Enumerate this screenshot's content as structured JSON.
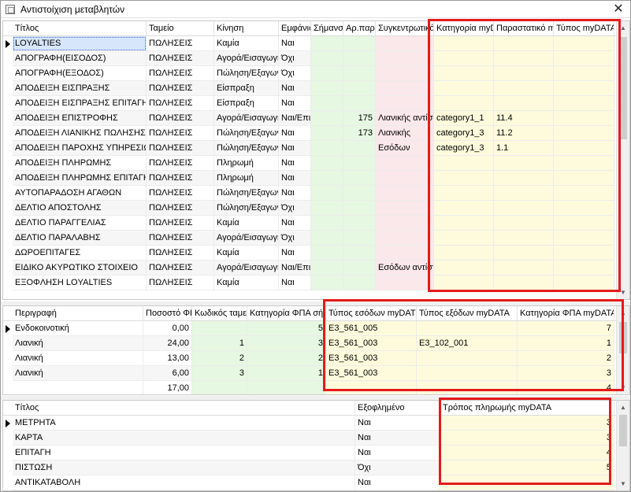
{
  "window": {
    "title": "Αντιστοίχιση μεταβλητών",
    "close_glyph": "✕"
  },
  "grid1": {
    "columns": [
      "Τίτλος",
      "Ταμείο",
      "Κίνηση",
      "Εμφάνισ",
      "Σήμανσ",
      "Αρ.παρ",
      "Συγκεντρωτικό",
      "Κατηγορία myDATA",
      "Παραστατικό myDATA",
      "Τύπος myDATA"
    ],
    "rows": [
      [
        "LOYALTIES",
        "ΠΩΛΗΣΕΙΣ",
        "Καμία",
        "Ναι",
        "",
        "",
        "",
        "",
        "",
        ""
      ],
      [
        "ΑΠΟΓΡΑΦΗ(ΕΙΣΟΔΟΣ)",
        "ΠΩΛΗΣΕΙΣ",
        "Αγορά/Εισαγωγή",
        "Όχι",
        "",
        "",
        "",
        "",
        "",
        ""
      ],
      [
        "ΑΠΟΓΡΑΦΗ(ΕΞΟΔΟΣ)",
        "ΠΩΛΗΣΕΙΣ",
        "Πώληση/Εξαγωγή",
        "Όχι",
        "",
        "",
        "",
        "",
        "",
        ""
      ],
      [
        "ΑΠΟΔΕΙΞΗ ΕΙΣΠΡΑΞΗΣ",
        "ΠΩΛΗΣΕΙΣ",
        "Είσπραξη",
        "Ναι",
        "",
        "",
        "",
        "",
        "",
        ""
      ],
      [
        "ΑΠΟΔΕΙΞΗ ΕΙΣΠΡΑΞΗΣ ΕΠΙΤΑΓΗ",
        "ΠΩΛΗΣΕΙΣ",
        "Είσπραξη",
        "Ναι",
        "",
        "",
        "",
        "",
        "",
        ""
      ],
      [
        "ΑΠΟΔΕΙΞΗ ΕΠΙΣΤΡΟΦΗΣ",
        "ΠΩΛΗΣΕΙΣ",
        "Αγορά/Εισαγωγή",
        "Ναι/Επιτ",
        "",
        "175",
        "Λιανικής αντίστ",
        "category1_1",
        "11.4",
        ""
      ],
      [
        "ΑΠΟΔΕΙΞΗ ΛΙΑΝΙΚΗΣ ΠΩΛΗΣΗΣ",
        "ΠΩΛΗΣΕΙΣ",
        "Πώληση/Εξαγωγή",
        "Ναι",
        "",
        "173",
        "Λιανικής",
        "category1_3",
        "11.2",
        ""
      ],
      [
        "ΑΠΟΔΕΙΞΗ ΠΑΡΟΧΗΣ ΥΠΗΡΕΣΙΩΝ",
        "ΠΩΛΗΣΕΙΣ",
        "Πώληση/Εξαγωγή",
        "Ναι",
        "",
        "",
        "Εσόδων",
        "category1_3",
        "1.1",
        ""
      ],
      [
        "ΑΠΟΔΕΙΞΗ ΠΛΗΡΩΜΗΣ",
        "ΠΩΛΗΣΕΙΣ",
        "Πληρωμή",
        "Ναι",
        "",
        "",
        "",
        "",
        "",
        ""
      ],
      [
        "ΑΠΟΔΕΙΞΗ ΠΛΗΡΩΜΗΣ ΕΠΙΤΑΓΗ",
        "ΠΩΛΗΣΕΙΣ",
        "Πληρωμή",
        "Ναι",
        "",
        "",
        "",
        "",
        "",
        ""
      ],
      [
        "ΑΥΤΟΠΑΡΑΔΟΣΗ ΑΓΑΘΩΝ",
        "ΠΩΛΗΣΕΙΣ",
        "Πώληση/Εξαγωγή",
        "Ναι",
        "",
        "",
        "",
        "",
        "",
        ""
      ],
      [
        "ΔΕΛΤΙΟ ΑΠΟΣΤΟΛΗΣ",
        "ΠΩΛΗΣΕΙΣ",
        "Πώληση/Εξαγωγή",
        "Όχι",
        "",
        "",
        "",
        "",
        "",
        ""
      ],
      [
        "ΔΕΛΤΙΟ ΠΑΡΑΓΓΕΛΙΑΣ",
        "ΠΩΛΗΣΕΙΣ",
        "Καμία",
        "Ναι",
        "",
        "",
        "",
        "",
        "",
        ""
      ],
      [
        "ΔΕΛΤΙΟ ΠΑΡΑΛΑΒΗΣ",
        "ΠΩΛΗΣΕΙΣ",
        "Αγορά/Εισαγωγή",
        "Όχι",
        "",
        "",
        "",
        "",
        "",
        ""
      ],
      [
        "ΔΩΡΟΕΠΙΤΑΓΕΣ",
        "ΠΩΛΗΣΕΙΣ",
        "Καμία",
        "Ναι",
        "",
        "",
        "",
        "",
        "",
        ""
      ],
      [
        "ΕΙΔΙΚΟ ΑΚΥΡΩΤΙΚΟ ΣΤΟΙΧΕΙΟ",
        "ΠΩΛΗΣΕΙΣ",
        "Αγορά/Εισαγωγή",
        "Ναι/Επιτ",
        "",
        "",
        "Εσόδων αντίστ",
        "",
        "",
        ""
      ],
      [
        "ΕΞΟΦΛΗΣΗ LOYALTIES",
        "ΠΩΛΗΣΕΙΣ",
        "Καμία",
        "Ναι",
        "",
        "",
        "",
        "",
        "",
        ""
      ]
    ]
  },
  "grid2": {
    "columns": [
      "Περιγραφή",
      "Ποσοστό ΦΠ",
      "Κωδικός ταμει",
      "Κατηγορία ΦΠΑ σήμ",
      "Τύπος εσόδων myDAT",
      "Τύπος εξόδων myDATA",
      "Κατηγορία ΦΠΑ myDATA"
    ],
    "rows": [
      [
        "Ενδοκοινοτική",
        "0,00",
        "",
        "5",
        "E3_561_005",
        "",
        "7"
      ],
      [
        "Λιανική",
        "24,00",
        "1",
        "3",
        "E3_561_003",
        "E3_102_001",
        "1"
      ],
      [
        "Λιανική",
        "13,00",
        "2",
        "2",
        "E3_561_003",
        "",
        "2"
      ],
      [
        "Λιανική",
        "6,00",
        "3",
        "1",
        "E3_561_003",
        "",
        "3"
      ],
      [
        "",
        "17,00",
        "",
        "",
        "",
        "",
        "4"
      ]
    ]
  },
  "grid3": {
    "columns": [
      "Τίτλος",
      "Εξοφλημένο",
      "Τρόπος πληρωμής myDATA"
    ],
    "rows": [
      [
        "ΜΕΤΡΗΤΑ",
        "Ναι",
        "3"
      ],
      [
        "ΚΑΡΤΑ",
        "Ναι",
        "3"
      ],
      [
        "ΕΠΙΤΑΓΗ",
        "Ναι",
        "4"
      ],
      [
        "ΠΙΣΤΩΣΗ",
        "Όχι",
        "5"
      ],
      [
        "ΑΝΤΙΚΑΤΑΒΟΛΗ",
        "Ναι",
        ""
      ]
    ]
  },
  "colors": {
    "highlight_red": "#e41b1b",
    "green_tint": "#e6f7e2",
    "pink_tint": "#fbe8ea",
    "yellow_tint": "#fdfbdc"
  },
  "icons": {
    "window_icon": "window-icon",
    "close": "close-icon",
    "row_pointer": "row-pointer-icon",
    "scroll_up": "scroll-up-icon",
    "scroll_down": "scroll-down-icon"
  }
}
